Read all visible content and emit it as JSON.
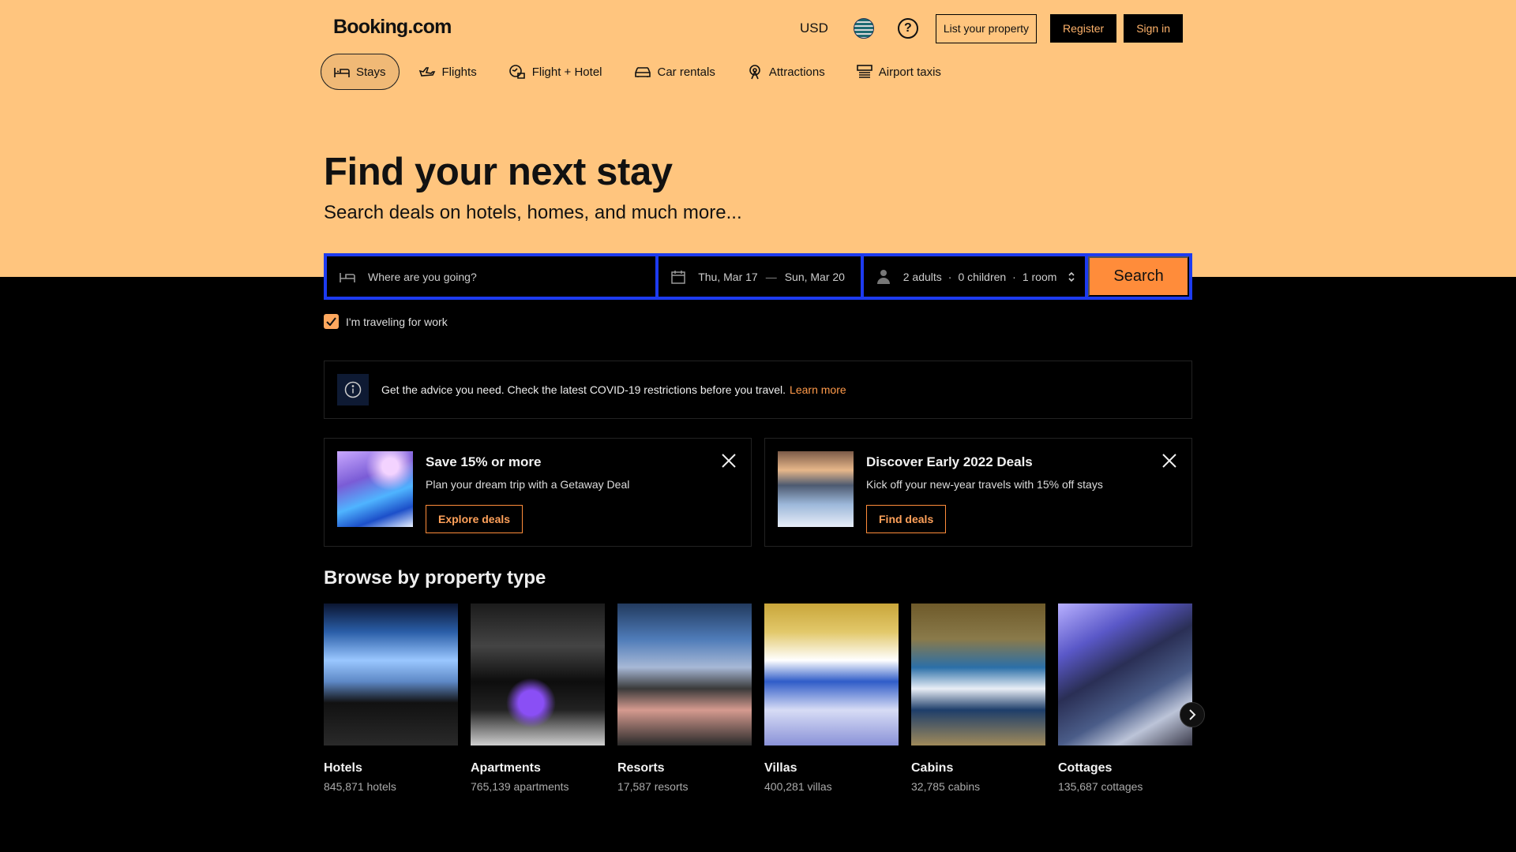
{
  "header": {
    "logo": "Booking.com",
    "currency": "USD",
    "list_property": "List your property",
    "register": "Register",
    "sign_in": "Sign in"
  },
  "tabs": [
    {
      "label": "Stays",
      "icon": "bed-icon",
      "active": true
    },
    {
      "label": "Flights",
      "icon": "plane-icon"
    },
    {
      "label": "Flight + Hotel",
      "icon": "plane-hotel-icon"
    },
    {
      "label": "Car rentals",
      "icon": "car-icon"
    },
    {
      "label": "Attractions",
      "icon": "attractions-icon"
    },
    {
      "label": "Airport taxis",
      "icon": "taxi-icon"
    }
  ],
  "hero": {
    "title": "Find your next stay",
    "subtitle": "Search deals on hotels, homes, and much more..."
  },
  "search": {
    "destination_placeholder": "Where are you going?",
    "check_in": "Thu, Mar 17",
    "dash": "—",
    "check_out": "Sun, Mar 20",
    "adults": "2 adults",
    "separator": "·",
    "children": "0 children",
    "rooms": "1 room",
    "button": "Search",
    "work_travel": "I'm traveling for work",
    "work_travel_checked": true
  },
  "notice": {
    "text": "Get the advice you need. Check the latest COVID-19 restrictions before you travel.",
    "link": "Learn more"
  },
  "promos": [
    {
      "title": "Save 15% or more",
      "text": "Plan your dream trip with a Getaway Deal",
      "button": "Explore deals"
    },
    {
      "title": "Discover Early 2022 Deals",
      "text": "Kick off your new-year travels with 15% off stays",
      "button": "Find deals"
    }
  ],
  "browse": {
    "title": "Browse by property type",
    "items": [
      {
        "name": "Hotels",
        "count": "845,871 hotels"
      },
      {
        "name": "Apartments",
        "count": "765,139 apartments"
      },
      {
        "name": "Resorts",
        "count": "17,587 resorts"
      },
      {
        "name": "Villas",
        "count": "400,281 villas"
      },
      {
        "name": "Cabins",
        "count": "32,785 cabins"
      },
      {
        "name": "Cottages",
        "count": "135,687 cottages"
      }
    ]
  },
  "colors": {
    "hero_bg": "#ffc57e",
    "search_border": "#1d3bf0",
    "search_button": "#ff8c3a",
    "accent": "#ff9a4a"
  }
}
